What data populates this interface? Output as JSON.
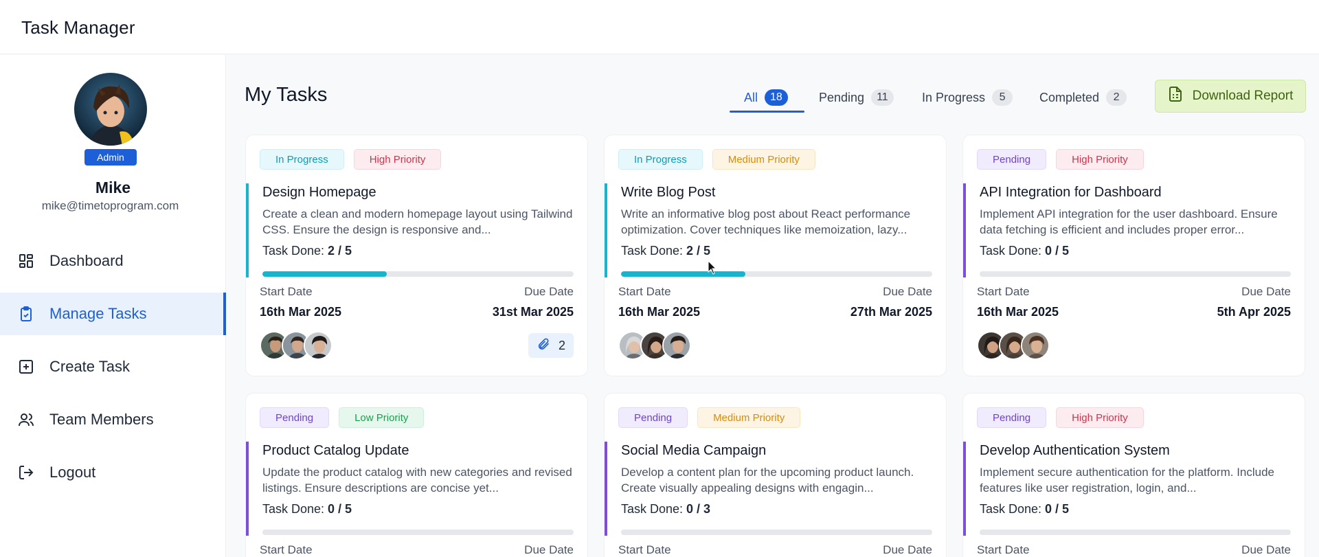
{
  "app": {
    "title": "Task Manager"
  },
  "user": {
    "role_badge": "Admin",
    "name": "Mike",
    "email": "mike@timetoprogram.com"
  },
  "nav": [
    {
      "label": "Dashboard",
      "icon": "dashboard-icon",
      "active": false
    },
    {
      "label": "Manage Tasks",
      "icon": "clipboard-check-icon",
      "active": true
    },
    {
      "label": "Create Task",
      "icon": "plus-square-icon",
      "active": false
    },
    {
      "label": "Team Members",
      "icon": "users-icon",
      "active": false
    },
    {
      "label": "Logout",
      "icon": "logout-icon",
      "active": false
    }
  ],
  "main": {
    "title": "My Tasks",
    "tabs": [
      {
        "label": "All",
        "count": "18",
        "active": true
      },
      {
        "label": "Pending",
        "count": "11",
        "active": false
      },
      {
        "label": "In Progress",
        "count": "5",
        "active": false
      },
      {
        "label": "Completed",
        "count": "2",
        "active": false
      }
    ],
    "download_label": "Download Report"
  },
  "labels": {
    "task_done": "Task Done: ",
    "start_date": "Start Date",
    "due_date": "Due Date"
  },
  "tasks": [
    {
      "status": "In Progress",
      "priority": "High Priority",
      "title": "Design Homepage",
      "description": "Create a clean and modern homepage layout using Tailwind CSS. Ensure the design is responsive and...",
      "done": "2 / 5",
      "progress": 0.4,
      "start": "16th Mar 2025",
      "due": "31st Mar 2025",
      "attachments": "2"
    },
    {
      "status": "In Progress",
      "priority": "Medium Priority",
      "title": "Write Blog Post",
      "description": "Write an informative blog post about React performance optimization. Cover techniques like memoization, lazy...",
      "done": "2 / 5",
      "progress": 0.4,
      "start": "16th Mar 2025",
      "due": "27th Mar 2025"
    },
    {
      "status": "Pending",
      "priority": "High Priority",
      "title": "API Integration for Dashboard",
      "description": "Implement API integration for the user dashboard. Ensure data fetching is efficient and includes proper error...",
      "done": "0 / 5",
      "progress": 0,
      "start": "16th Mar 2025",
      "due": "5th Apr 2025"
    },
    {
      "status": "Pending",
      "priority": "Low Priority",
      "title": "Product Catalog Update",
      "description": "Update the product catalog with new categories and revised listings. Ensure descriptions are concise yet...",
      "done": "0 / 5",
      "progress": 0,
      "start": "Start Date",
      "due": "Due Date"
    },
    {
      "status": "Pending",
      "priority": "Medium Priority",
      "title": "Social Media Campaign",
      "description": "Develop a content plan for the upcoming product launch. Create visually appealing designs with engagin...",
      "done": "0 / 3",
      "progress": 0
    },
    {
      "status": "Pending",
      "priority": "High Priority",
      "title": "Develop Authentication System",
      "description": "Implement secure authentication for the platform. Include features like user registration, login, and...",
      "done": "0 / 5",
      "progress": 0
    }
  ],
  "colors": {
    "accent": "#1d5fd6",
    "in_progress": "#17b3cf",
    "pending": "#7e4fd6",
    "high": "#d4324a",
    "medium": "#d68c0c",
    "low": "#15a34a",
    "download_bg": "#e6f5c9"
  }
}
